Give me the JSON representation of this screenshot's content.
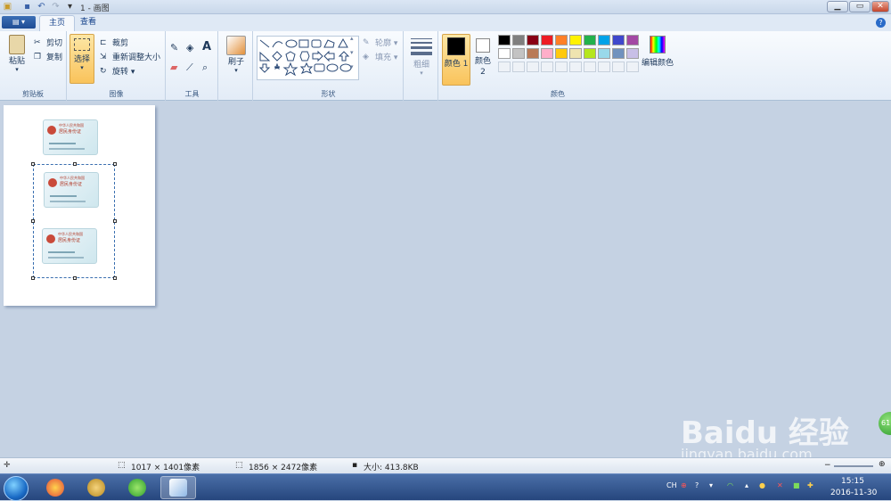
{
  "window": {
    "title": "1 - 画图"
  },
  "tabs": [
    {
      "label": "主页"
    },
    {
      "label": "查看"
    }
  ],
  "ribbon": {
    "clipboard": {
      "paste": "粘贴",
      "cut": "剪切",
      "copy": "复制",
      "group": "剪贴板"
    },
    "image": {
      "select": "选择",
      "crop": "裁剪",
      "resize": "重新调整大小",
      "rotate": "旋转",
      "group": "图像"
    },
    "tools": {
      "group": "工具"
    },
    "brushes": {
      "label": "刷子"
    },
    "shapes": {
      "outline": "轮廓",
      "fill": "填充",
      "group": "形状"
    },
    "size": {
      "label": "粗细"
    },
    "colors": {
      "color1": "颜色 1",
      "color2": "颜色 2",
      "edit": "编辑颜色",
      "group": "颜色",
      "palette_row1": [
        "#000000",
        "#7f7f7f",
        "#880015",
        "#ed1c24",
        "#ff7f27",
        "#fff200",
        "#22b14c",
        "#00a2e8",
        "#3f48cc",
        "#a349a4"
      ],
      "palette_row2": [
        "#ffffff",
        "#c3c3c3",
        "#b97a57",
        "#ffaec9",
        "#ffc90e",
        "#efe4b0",
        "#b5e61d",
        "#99d9ea",
        "#7092be",
        "#c8bfe7"
      ],
      "color1_value": "#000000",
      "color2_value": "#ffffff"
    }
  },
  "document": {
    "card_title": "中华人民共和国",
    "card_subtitle": "居民身份证"
  },
  "status": {
    "selection_size": "1017 × 1401像素",
    "image_size": "1856 × 2472像素",
    "file_size": "大小: 413.8KB"
  },
  "taskbar": {
    "lang": "CH",
    "time": "15:15",
    "date": "2016-11-30"
  },
  "watermark": {
    "main": "Baidu 经验",
    "sub": "jingyan.baidu.com",
    "badge": "61"
  }
}
